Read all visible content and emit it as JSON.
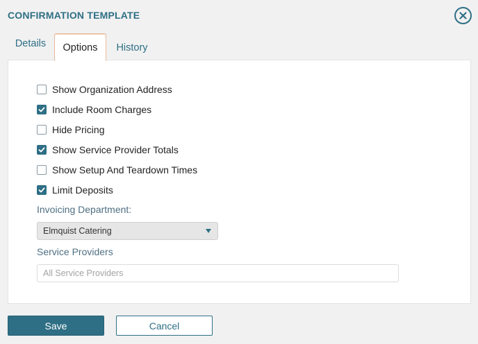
{
  "dialog": {
    "title": "CONFIRMATION TEMPLATE",
    "close_icon": "close-circle-icon"
  },
  "tabs": [
    {
      "label": "Details",
      "active": false
    },
    {
      "label": "Options",
      "active": true
    },
    {
      "label": "History",
      "active": false
    }
  ],
  "options": [
    {
      "label": "Show Organization Address",
      "checked": false
    },
    {
      "label": "Include Room Charges",
      "checked": true
    },
    {
      "label": "Hide Pricing",
      "checked": false
    },
    {
      "label": "Show Service Provider Totals",
      "checked": true
    },
    {
      "label": "Show Setup And Teardown Times",
      "checked": false
    },
    {
      "label": "Limit Deposits",
      "checked": true
    }
  ],
  "invoicing": {
    "label": "Invoicing Department:",
    "selected": "Elmquist Catering"
  },
  "service_providers": {
    "label": "Service Providers",
    "value": "",
    "placeholder": "All Service Providers"
  },
  "buttons": {
    "save": "Save",
    "cancel": "Cancel"
  },
  "colors": {
    "accent": "#2e6f85",
    "active_tab_border": "#e9b999"
  }
}
